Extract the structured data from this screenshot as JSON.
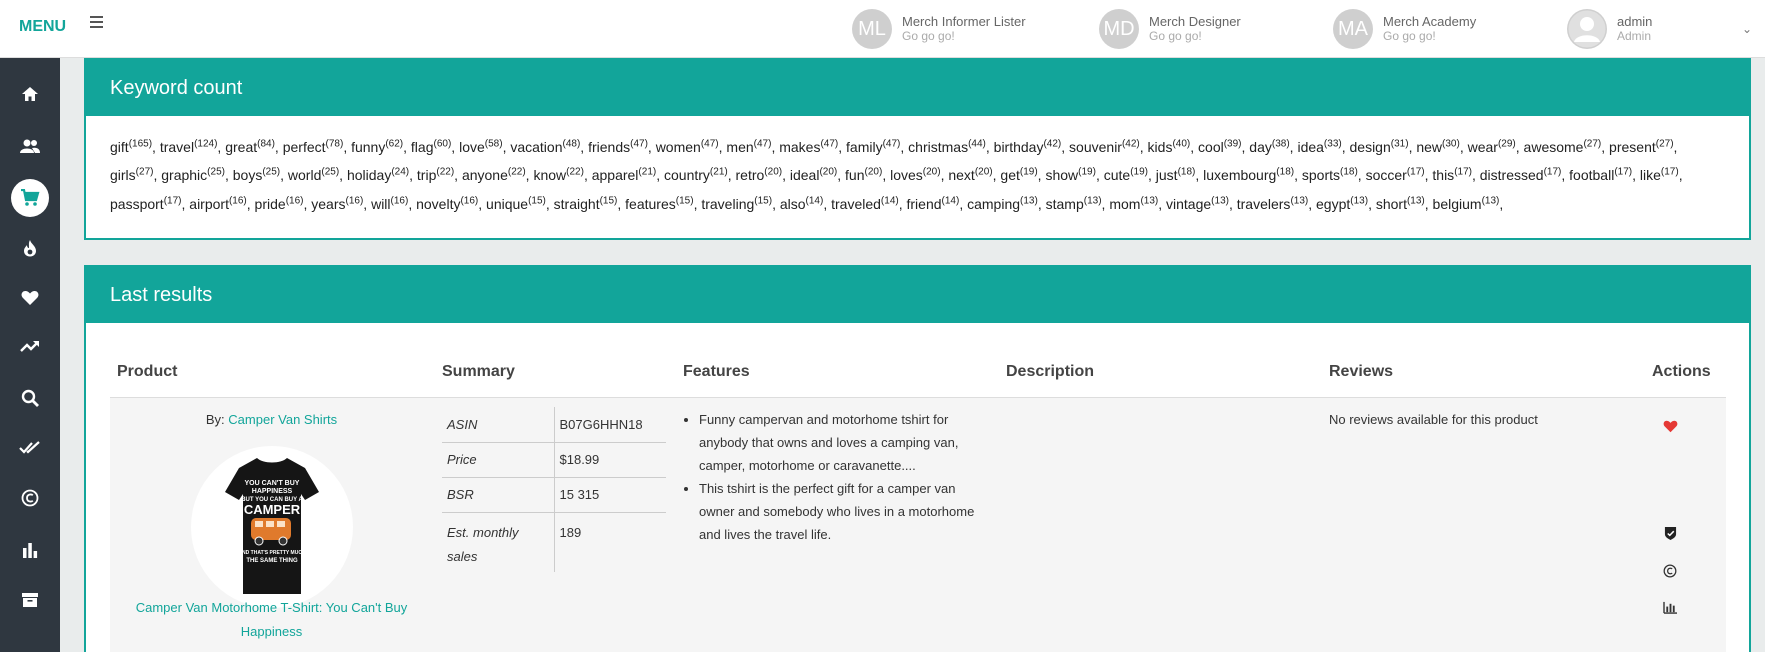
{
  "header": {
    "menu_label": "MENU",
    "apps": [
      {
        "initials": "ML",
        "name": "Merch Informer Lister",
        "sub": "Go go go!"
      },
      {
        "initials": "MD",
        "name": "Merch Designer",
        "sub": "Go go go!"
      },
      {
        "initials": "MA",
        "name": "Merch Academy",
        "sub": "Go go go!"
      }
    ],
    "user": {
      "name": "admin",
      "role": "Admin"
    }
  },
  "sidebar": {
    "items": [
      "home-icon",
      "users-icon",
      "cart-icon",
      "fire-icon",
      "heart-icon",
      "trending-icon",
      "search-icon",
      "double-check-icon",
      "copyright-icon",
      "bar-chart-icon",
      "archive-icon"
    ],
    "active": "cart-icon"
  },
  "keyword_card": {
    "title": "Keyword count",
    "keywords": [
      {
        "w": "gift",
        "c": "165"
      },
      {
        "w": "travel",
        "c": "124"
      },
      {
        "w": "great",
        "c": "84"
      },
      {
        "w": "perfect",
        "c": "78"
      },
      {
        "w": "funny",
        "c": "62"
      },
      {
        "w": "flag",
        "c": "60"
      },
      {
        "w": "love",
        "c": "58"
      },
      {
        "w": "vacation",
        "c": "48"
      },
      {
        "w": "friends",
        "c": "47"
      },
      {
        "w": "women",
        "c": "47"
      },
      {
        "w": "men",
        "c": "47"
      },
      {
        "w": "makes",
        "c": "47"
      },
      {
        "w": "family",
        "c": "47"
      },
      {
        "w": "christmas",
        "c": "44"
      },
      {
        "w": "birthday",
        "c": "42"
      },
      {
        "w": "souvenir",
        "c": "42"
      },
      {
        "w": "kids",
        "c": "40"
      },
      {
        "w": "cool",
        "c": "39"
      },
      {
        "w": "day",
        "c": "38"
      },
      {
        "w": "idea",
        "c": "33"
      },
      {
        "w": "design",
        "c": "31"
      },
      {
        "w": "new",
        "c": "30"
      },
      {
        "w": "wear",
        "c": "29"
      },
      {
        "w": "awesome",
        "c": "27"
      },
      {
        "w": "present",
        "c": "27"
      },
      {
        "w": "girls",
        "c": "27"
      },
      {
        "w": "graphic",
        "c": "25"
      },
      {
        "w": "boys",
        "c": "25"
      },
      {
        "w": "world",
        "c": "25"
      },
      {
        "w": "holiday",
        "c": "24"
      },
      {
        "w": "trip",
        "c": "22"
      },
      {
        "w": "anyone",
        "c": "22"
      },
      {
        "w": "know",
        "c": "22"
      },
      {
        "w": "apparel",
        "c": "21"
      },
      {
        "w": "country",
        "c": "21"
      },
      {
        "w": "retro",
        "c": "20"
      },
      {
        "w": "ideal",
        "c": "20"
      },
      {
        "w": "fun",
        "c": "20"
      },
      {
        "w": "loves",
        "c": "20"
      },
      {
        "w": "next",
        "c": "20"
      },
      {
        "w": "get",
        "c": "19"
      },
      {
        "w": "show",
        "c": "19"
      },
      {
        "w": "cute",
        "c": "19"
      },
      {
        "w": "just",
        "c": "18"
      },
      {
        "w": "luxembourg",
        "c": "18"
      },
      {
        "w": "sports",
        "c": "18"
      },
      {
        "w": "soccer",
        "c": "17"
      },
      {
        "w": "this",
        "c": "17"
      },
      {
        "w": "distressed",
        "c": "17"
      },
      {
        "w": "football",
        "c": "17"
      },
      {
        "w": "like",
        "c": "17"
      },
      {
        "w": "passport",
        "c": "17"
      },
      {
        "w": "airport",
        "c": "16"
      },
      {
        "w": "pride",
        "c": "16"
      },
      {
        "w": "years",
        "c": "16"
      },
      {
        "w": "will",
        "c": "16"
      },
      {
        "w": "novelty",
        "c": "16"
      },
      {
        "w": "unique",
        "c": "15"
      },
      {
        "w": "straight",
        "c": "15"
      },
      {
        "w": "features",
        "c": "15"
      },
      {
        "w": "traveling",
        "c": "15"
      },
      {
        "w": "also",
        "c": "14"
      },
      {
        "w": "traveled",
        "c": "14"
      },
      {
        "w": "friend",
        "c": "14"
      },
      {
        "w": "camping",
        "c": "13"
      },
      {
        "w": "stamp",
        "c": "13"
      },
      {
        "w": "mom",
        "c": "13"
      },
      {
        "w": "vintage",
        "c": "13"
      },
      {
        "w": "travelers",
        "c": "13"
      },
      {
        "w": "egypt",
        "c": "13"
      },
      {
        "w": "short",
        "c": "13"
      },
      {
        "w": "belgium",
        "c": "13"
      }
    ]
  },
  "results_card": {
    "title": "Last results",
    "columns": [
      "Product",
      "Summary",
      "Features",
      "Description",
      "Reviews",
      "Actions"
    ],
    "row": {
      "by_label": "By:",
      "brand": "Camper Van Shirts",
      "shirt_text": [
        "YOU CAN'T BUY",
        "HAPPINESS",
        "BUT YOU CAN BUY A",
        "CAMPER",
        "AND THAT'S PRETTY MUCH",
        "THE SAME THING"
      ],
      "product_title": "Camper Van Motorhome T-Shirt: You Can't Buy Happiness",
      "summary": [
        {
          "k": "ASIN",
          "v": "B07G6HHN18"
        },
        {
          "k": "Price",
          "v": "$18.99"
        },
        {
          "k": "BSR",
          "v": "15 315"
        },
        {
          "k": "Est. monthly sales",
          "v": "189"
        }
      ],
      "features": [
        "Funny campervan and motorhome tshirt for anybody that owns and loves a camping van, camper, motorhome or caravanette....",
        "This tshirt is the perfect gift for a camper van owner and somebody who lives in a motorhome and lives the travel life."
      ],
      "reviews": "No reviews available for this product",
      "actions": [
        "heart-icon",
        "shield-check-icon",
        "copyright-icon",
        "bar-chart-icon"
      ],
      "colors": {
        "heart": "#e53935",
        "accent": "#12a59a"
      }
    }
  }
}
